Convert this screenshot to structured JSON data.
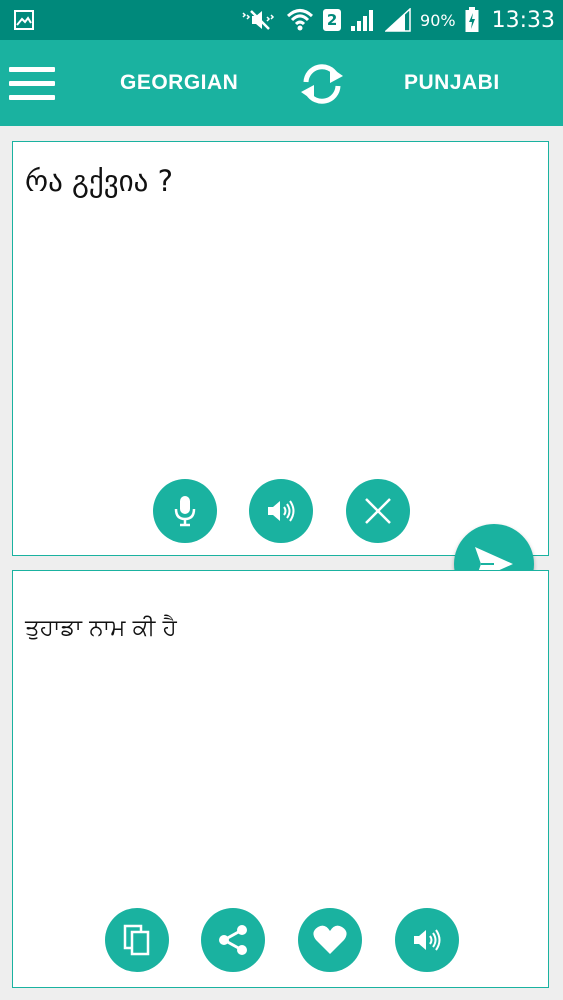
{
  "status_bar": {
    "battery_text": "90%",
    "time": "13:33",
    "sim_number": "2",
    "icons": [
      "gallery-icon",
      "mute-icon",
      "wifi-icon",
      "sim-2-icon",
      "signal-icon",
      "signal-icon",
      "battery-charging-icon"
    ]
  },
  "app_bar": {
    "source_language": "GEORGIAN",
    "target_language": "PUNJABI",
    "icons": [
      "menu-icon",
      "swap-languages-icon"
    ]
  },
  "input_panel": {
    "text": "რა გქვია ?",
    "buttons": [
      "microphone-icon",
      "speaker-icon",
      "clear-icon"
    ]
  },
  "output_panel": {
    "text": "ਤੁਹਾਡਾ ਨਾਮ ਕੀ ਹੈ",
    "buttons": [
      "copy-icon",
      "share-icon",
      "favorite-icon",
      "speaker-icon"
    ]
  },
  "colors": {
    "status_bar": "#00897b",
    "accent": "#1ab2a0",
    "background": "#eeeeee",
    "panel": "#ffffff"
  }
}
